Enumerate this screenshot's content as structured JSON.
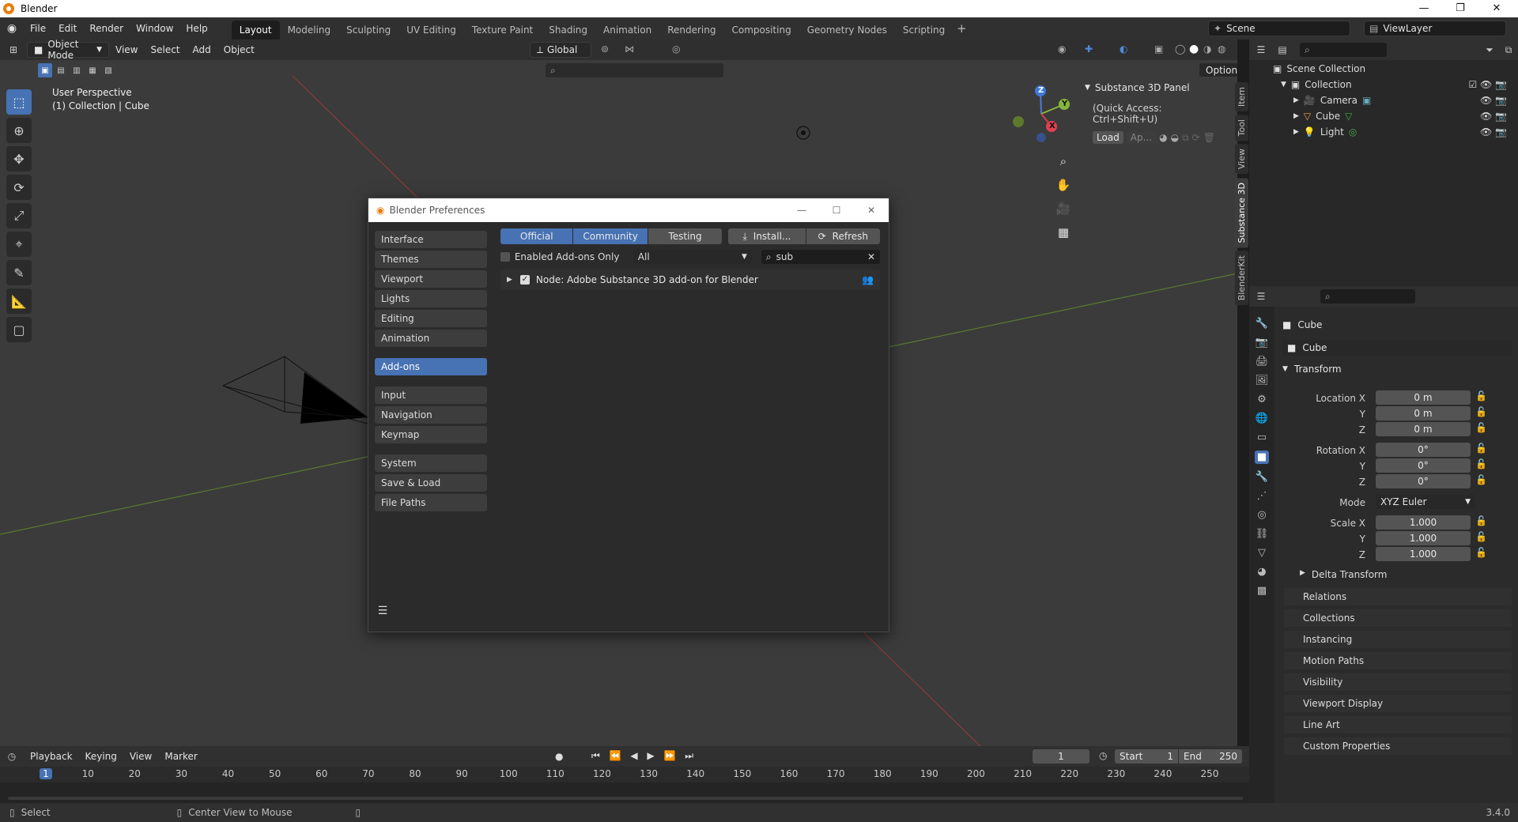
{
  "window": {
    "title": "Blender",
    "minimize": "—",
    "restore": "❐",
    "close": "✕"
  },
  "menus": [
    "File",
    "Edit",
    "Render",
    "Window",
    "Help"
  ],
  "workspaces": [
    "Layout",
    "Modeling",
    "Sculpting",
    "UV Editing",
    "Texture Paint",
    "Shading",
    "Animation",
    "Rendering",
    "Compositing",
    "Geometry Nodes",
    "Scripting"
  ],
  "active_workspace": "Layout",
  "scene_field": "Scene",
  "viewlayer_field": "ViewLayer",
  "vp_header": {
    "mode": "Object Mode",
    "view": "View",
    "select": "Select",
    "add": "Add",
    "object": "Object",
    "transform": "Global",
    "options": "Options"
  },
  "viewport": {
    "perspective": "User Perspective",
    "collection": "(1) Collection | Cube"
  },
  "gizmo": {
    "z": "Z",
    "y": "Y",
    "x": "X"
  },
  "s3d": {
    "header": "Substance 3D Panel",
    "quick": "(Quick Access: Ctrl+Shift+U)",
    "load": "Load",
    "apply": "Ap..."
  },
  "side_tabs": [
    "Item",
    "Tool",
    "View",
    "Substance 3D",
    "BlenderKit"
  ],
  "prefs": {
    "title": "Blender Preferences",
    "categories": [
      "Interface",
      "Themes",
      "Viewport",
      "Lights",
      "Editing",
      "Animation",
      "Add-ons",
      "Input",
      "Navigation",
      "Keymap",
      "System",
      "Save & Load",
      "File Paths"
    ],
    "active_category": "Add-ons",
    "tabs": [
      "Official",
      "Community",
      "Testing"
    ],
    "install": "Install...",
    "refresh": "Refresh",
    "enabled_only": "Enabled Add-ons Only",
    "filter": "All",
    "search": "sub",
    "addon": "Node: Adobe Substance 3D add-on for Blender"
  },
  "outliner": {
    "root": "Scene Collection",
    "collection": "Collection",
    "items": [
      "Camera",
      "Cube",
      "Light"
    ]
  },
  "props": {
    "object_name": "Cube",
    "datablock": "Cube",
    "transform": "Transform",
    "location_label": "Location X",
    "rotation_label": "Rotation X",
    "scale_label": "Scale X",
    "y": "Y",
    "z": "Z",
    "location": [
      "0 m",
      "0 m",
      "0 m"
    ],
    "rotation": [
      "0°",
      "0°",
      "0°"
    ],
    "mode_label": "Mode",
    "mode": "XYZ Euler",
    "scale": [
      "1.000",
      "1.000",
      "1.000"
    ],
    "delta": "Delta Transform",
    "panels": [
      "Relations",
      "Collections",
      "Instancing",
      "Motion Paths",
      "Visibility",
      "Viewport Display",
      "Line Art",
      "Custom Properties"
    ]
  },
  "timeline": {
    "playback": "Playback",
    "keying": "Keying",
    "view": "View",
    "marker": "Marker",
    "frame": "1",
    "start_label": "Start",
    "start": "1",
    "end_label": "End",
    "end": "250",
    "ticks": [
      "1",
      "10",
      "20",
      "30",
      "40",
      "50",
      "60",
      "70",
      "80",
      "90",
      "100",
      "110",
      "120",
      "130",
      "140",
      "150",
      "160",
      "170",
      "180",
      "190",
      "200",
      "210",
      "220",
      "230",
      "240",
      "250"
    ]
  },
  "status": {
    "select": "Select",
    "center": "Center View to Mouse",
    "version": "3.4.0"
  }
}
